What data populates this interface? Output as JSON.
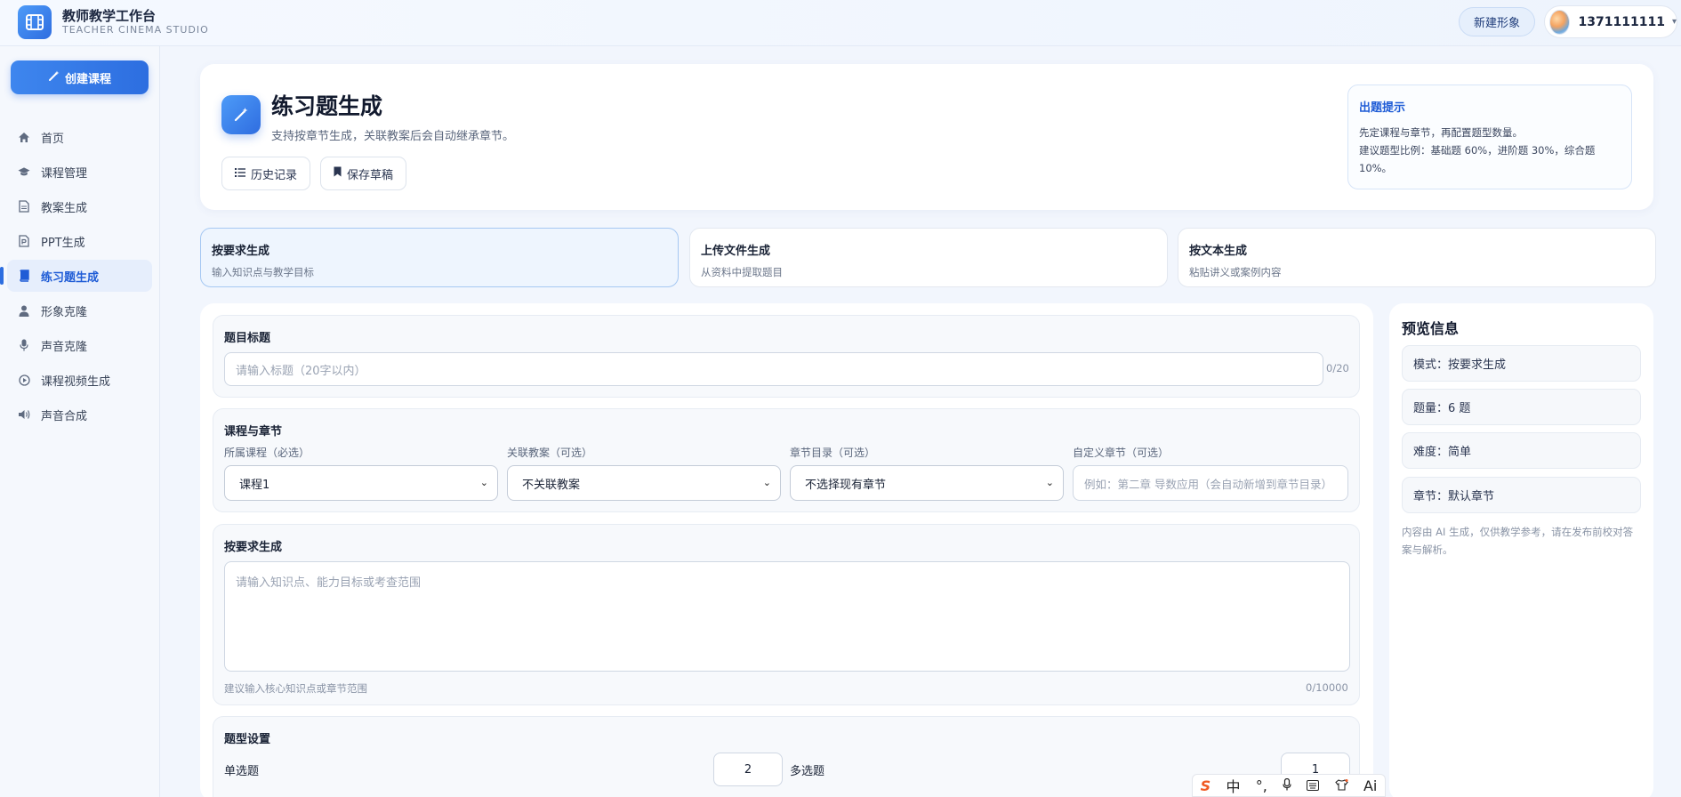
{
  "header": {
    "app_title": "教师教学工作台",
    "app_subtitle": "TEACHER CINEMA STUDIO",
    "new_avatar_label": "新建形象",
    "username": "1371111111"
  },
  "sidebar": {
    "create_label": "创建课程",
    "items": [
      {
        "label": "首页",
        "icon": "home-icon"
      },
      {
        "label": "课程管理",
        "icon": "graduation-cap-icon"
      },
      {
        "label": "教案生成",
        "icon": "document-icon"
      },
      {
        "label": "PPT生成",
        "icon": "ppt-file-icon"
      },
      {
        "label": "练习题生成",
        "icon": "book-icon",
        "active": true
      },
      {
        "label": "形象克隆",
        "icon": "user-icon"
      },
      {
        "label": "声音克隆",
        "icon": "microphone-icon"
      },
      {
        "label": "课程视频生成",
        "icon": "play-circle-icon"
      },
      {
        "label": "声音合成",
        "icon": "volume-icon"
      }
    ]
  },
  "hero": {
    "title": "练习题生成",
    "subtitle": "支持按章节生成，关联教案后会自动继承章节。",
    "history_label": "历史记录",
    "save_label": "保存草稿",
    "tip": {
      "title": "出题提示",
      "line1": "先定课程与章节，再配置题型数量。",
      "line2": "建议题型比例：基础题 60%，进阶题 30%，综合题",
      "line3": "10%。"
    }
  },
  "modes": [
    {
      "title": "按要求生成",
      "sub": "输入知识点与教学目标"
    },
    {
      "title": "上传文件生成",
      "sub": "从资料中提取题目"
    },
    {
      "title": "按文本生成",
      "sub": "粘贴讲义或案例内容"
    }
  ],
  "form": {
    "title_section": {
      "label": "题目标题",
      "placeholder": "请输入标题（20字以内）",
      "count": "0/20"
    },
    "course_section": {
      "label": "课程与章节",
      "course_label": "所属课程（必选）",
      "course_value": "课程1",
      "plan_label": "关联教案（可选）",
      "plan_value": "不关联教案",
      "chapter_label": "章节目录（可选）",
      "chapter_value": "不选择现有章节",
      "custom_label": "自定义章节（可选）",
      "custom_placeholder": "例如：第二章 导数应用（会自动新增到章节目录）"
    },
    "req_section": {
      "label": "按要求生成",
      "placeholder": "请输入知识点、能力目标或考查范围",
      "hint": "建议输入核心知识点或章节范围",
      "count": "0/10000"
    },
    "type_section": {
      "label": "题型设置",
      "single_label": "单选题",
      "single_value": "2",
      "multi_label": "多选题",
      "multi_value": "1"
    }
  },
  "preview": {
    "title": "预览信息",
    "mode": "模式：按要求生成",
    "count": "题量：6 题",
    "difficulty": "难度：简单",
    "chapter": "章节：默认章节",
    "note": "内容由 AI 生成，仅供教学参考，请在发布前校对答案与解析。"
  },
  "ime": {
    "lang": "中"
  },
  "colors": {
    "accent": "#2d6ee0",
    "background": "#f2f6fd"
  }
}
